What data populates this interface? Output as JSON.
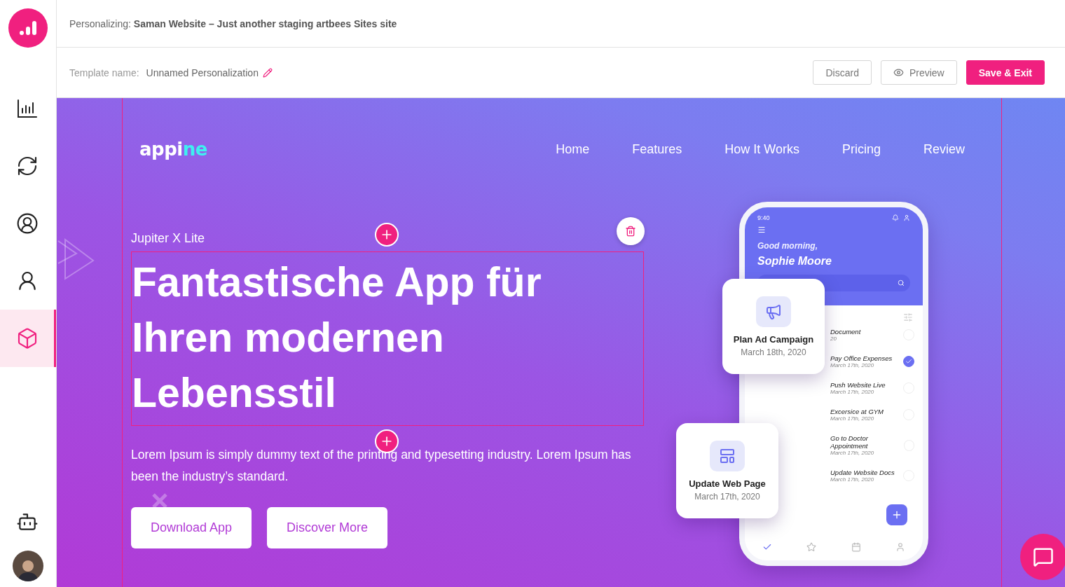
{
  "sidebar": {
    "items": [
      {
        "selected": false
      },
      {
        "selected": false
      },
      {
        "selected": false
      },
      {
        "selected": false
      },
      {
        "selected": true
      }
    ]
  },
  "header": {
    "label": "Personalizing:",
    "site": "Saman Website – Just another staging artbees Sites site"
  },
  "toolbar": {
    "template_label": "Template name:",
    "template_name": "Unnamed Personalization",
    "buttons": [
      {
        "label": "Discard",
        "kind": "plain"
      },
      {
        "label": "Preview",
        "kind": "preview"
      },
      {
        "label": "Save & Exit",
        "kind": "primary"
      }
    ]
  },
  "site": {
    "logo": {
      "text": "appi",
      "accent": "ne"
    },
    "nav": [
      "Home",
      "Features",
      "How It Works",
      "Pricing",
      "Review"
    ],
    "eyebrow": "Jupiter X Lite",
    "headline": "Fantastische App für Ihren modernen Lebensstil",
    "paragraph": "Lorem Ipsum is simply dummy text of the printing and typesetting industry. Lorem Ipsum has been the industry’s standard.",
    "buttons": [
      "Download App",
      "Discover More"
    ],
    "phone": {
      "time": "9:40",
      "greeting": "Good morning,",
      "name": "Sophie Moore",
      "tasks": [
        {
          "title": "Document",
          "date": "20",
          "done": false
        },
        {
          "title": "Pay Office Expenses",
          "date": "March 17th, 2020",
          "done": true
        },
        {
          "title": "Push Website Live",
          "date": "March 17th, 2020",
          "done": false
        },
        {
          "title": "Excersice at GYM",
          "date": "March 17th, 2020",
          "done": false
        },
        {
          "title": "Go to Doctor Appointment",
          "date": "March 17th, 2020",
          "done": false
        },
        {
          "title": "Update Website Docs",
          "date": "March 17th, 2020",
          "done": false
        }
      ],
      "cards": [
        {
          "title": "Plan Ad Campaign",
          "date": "March 18th, 2020"
        },
        {
          "title": "Update Web Page",
          "date": "March 17th, 2020"
        }
      ]
    }
  }
}
